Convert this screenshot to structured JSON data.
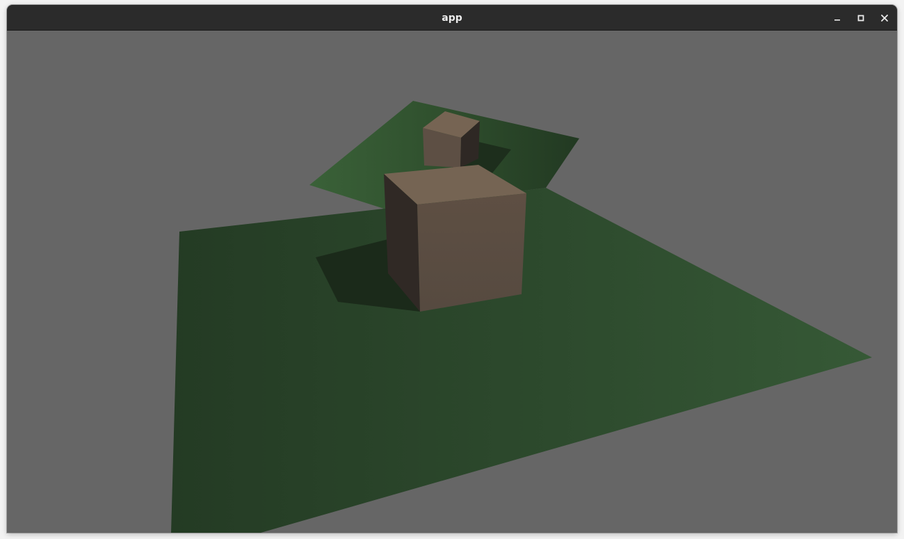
{
  "window": {
    "title": "app"
  },
  "controls": {
    "minimize_icon": "minimize-icon",
    "maximize_icon": "maximize-icon",
    "close_icon": "close-icon"
  },
  "scene": {
    "background_color": "#666666",
    "ground_color": "#2e4a2e",
    "cube_color": "#6b5a4c",
    "shadow_color": "#1b2a1b"
  }
}
